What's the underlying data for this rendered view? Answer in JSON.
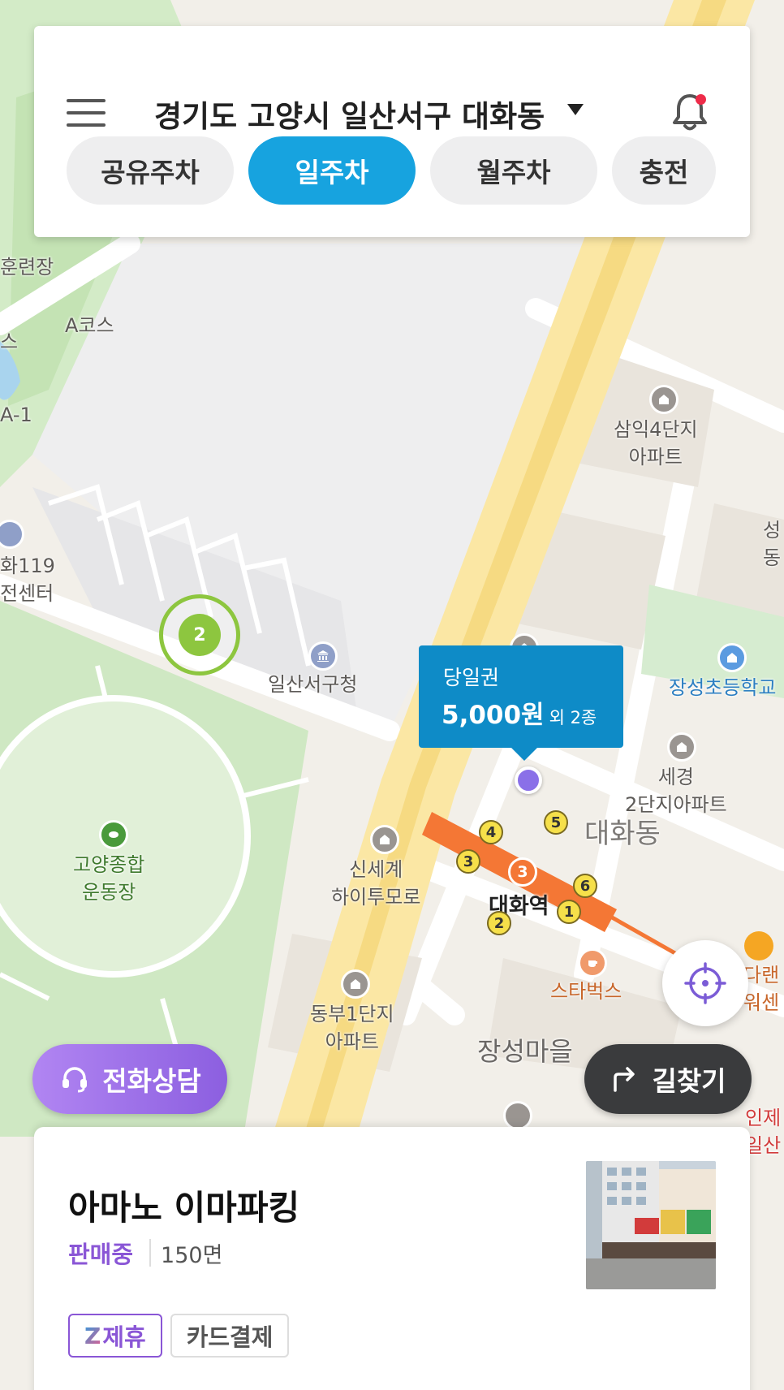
{
  "header": {
    "menu_icon": "hamburger-icon",
    "region": "경기도 고양시 일산서구 대화동",
    "bell_icon": "bell-icon",
    "tabs": [
      {
        "label": "공유주차",
        "active": false
      },
      {
        "label": "일주차",
        "active": true
      },
      {
        "label": "월주차",
        "active": false
      },
      {
        "label": "충전",
        "active": false
      }
    ]
  },
  "map": {
    "labels": {
      "training": "훈련장",
      "a_course": "A코스",
      "s_partial": "스",
      "a1": "A-1",
      "safety_center": "화119\n전센터",
      "district_office": "일산서구청",
      "samik": "삼익4단지\n아파트",
      "dong_partial": "성\n동",
      "jangseong_school": "장성초등학교",
      "sekyung": "세경\n2단지아파트",
      "daehwa_dong": "대화동",
      "shinsegae": "신세계\n하이투모로",
      "stadium": "고양종합\n운동장",
      "daehwa_station": "대화역",
      "starbucks": "스타벅스",
      "dongbu": "동부1단지\n아파트",
      "jangseong_village": "장성마을",
      "right_partial1": "다랜\n워센",
      "right_partial2": "인제\n일산"
    },
    "station_line_number": "3",
    "exits": [
      "1",
      "2",
      "3",
      "4",
      "5",
      "6"
    ],
    "cluster_count": "2",
    "price_bubble": {
      "title": "당일권",
      "price": "5,000원",
      "extra": "외 2종"
    },
    "colors": {
      "line3": "#f47735",
      "cluster": "#8dc63f",
      "bubble": "#0e8bc7",
      "active_tab": "#17a3df"
    }
  },
  "buttons": {
    "gps_icon": "crosshair-icon",
    "call": "전화상담",
    "call_icon": "headset-icon",
    "directions": "길찾기",
    "directions_icon": "turn-right-arrow-icon"
  },
  "card": {
    "name": "아마노 이마파킹",
    "status": "판매중",
    "spaces": "150면",
    "chips": [
      "제휴",
      "카드결제"
    ],
    "partner_logo": "Z"
  }
}
